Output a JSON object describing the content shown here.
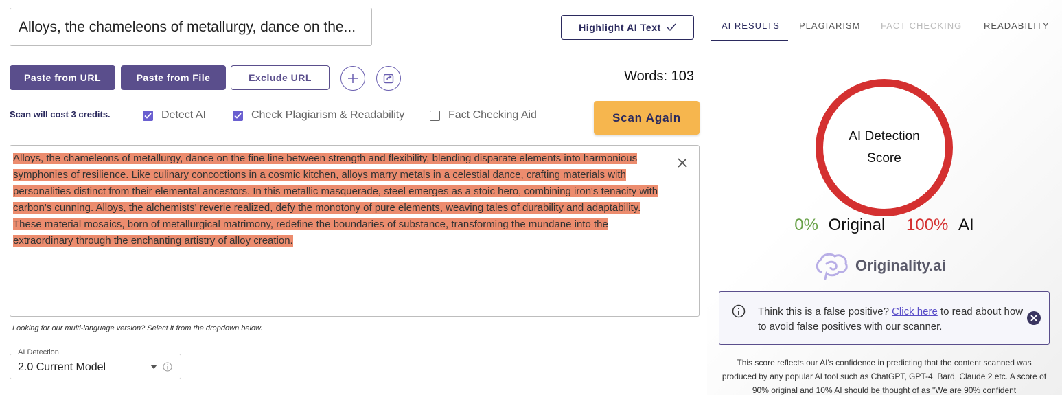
{
  "input": {
    "title": "Alloys, the chameleons of metallurgy, dance on the..."
  },
  "toolbar": {
    "highlight_label": "Highlight AI Text",
    "paste_url_label": "Paste from URL",
    "paste_file_label": "Paste from File",
    "exclude_url_label": "Exclude URL",
    "add_icon": "plus-icon",
    "share_icon": "share-icon",
    "words_label": "Words: 103"
  },
  "options": {
    "cost_text": "Scan will cost 3 credits.",
    "detect_ai_label": "Detect AI",
    "detect_ai_checked": true,
    "plagiarism_label": "Check Plagiarism & Readability",
    "plagiarism_checked": true,
    "fact_label": "Fact Checking Aid",
    "fact_checked": false,
    "scan_label": "Scan Again"
  },
  "editor": {
    "lines": [
      "Alloys, the chameleons of metallurgy, dance on the fine line between strength and flexibility, blending disparate elements into harmonious",
      "symphonies of resilience. Like culinary concoctions in a cosmic kitchen, alloys marry metals in a celestial dance, crafting materials with",
      "personalities distinct from their elemental ancestors. In this metallic masquerade, steel emerges as a stoic hero, combining iron's tenacity with",
      "carbon's cunning. Alloys, the alchemists' reverie realized, defy the monotony of pure elements, weaving tales of durability and adaptability.",
      "These material mosaics, born of metallurgical matrimony, redefine the boundaries of substance, transforming the mundane into the",
      "extraordinary through the enchanting artistry of alloy creation."
    ],
    "highlight_color": "#ec8c6e"
  },
  "multi_lang_note": "Looking for our multi-language version? Select it from the dropdown below.",
  "model_select": {
    "legend": "AI Detection",
    "value": "2.0 Current Model"
  },
  "tabs": [
    {
      "label": "AI RESULTS",
      "state": "active"
    },
    {
      "label": "PLAGIARISM",
      "state": "normal"
    },
    {
      "label": "FACT CHECKING",
      "state": "disabled"
    },
    {
      "label": "READABILITY",
      "state": "normal"
    }
  ],
  "results": {
    "ring_line1": "AI Detection",
    "ring_line2": "Score",
    "original_pct": "0%",
    "original_label": "Original",
    "ai_pct": "100%",
    "ai_label": "AI",
    "ring_color": "#d43030",
    "logo_text": "Originality.ai"
  },
  "false_positive": {
    "prefix": "Think this is a false positive? ",
    "link": "Click here",
    "suffix": " to read about how to avoid false positives with our scanner."
  },
  "disclaimer": "This score reflects our AI's confidence in predicting that the content scanned was produced by any popular AI tool such as ChatGPT, GPT-4, Bard, Claude 2 etc. A score of 90% original and 10% AI should be thought of as \"We are 90% confident"
}
